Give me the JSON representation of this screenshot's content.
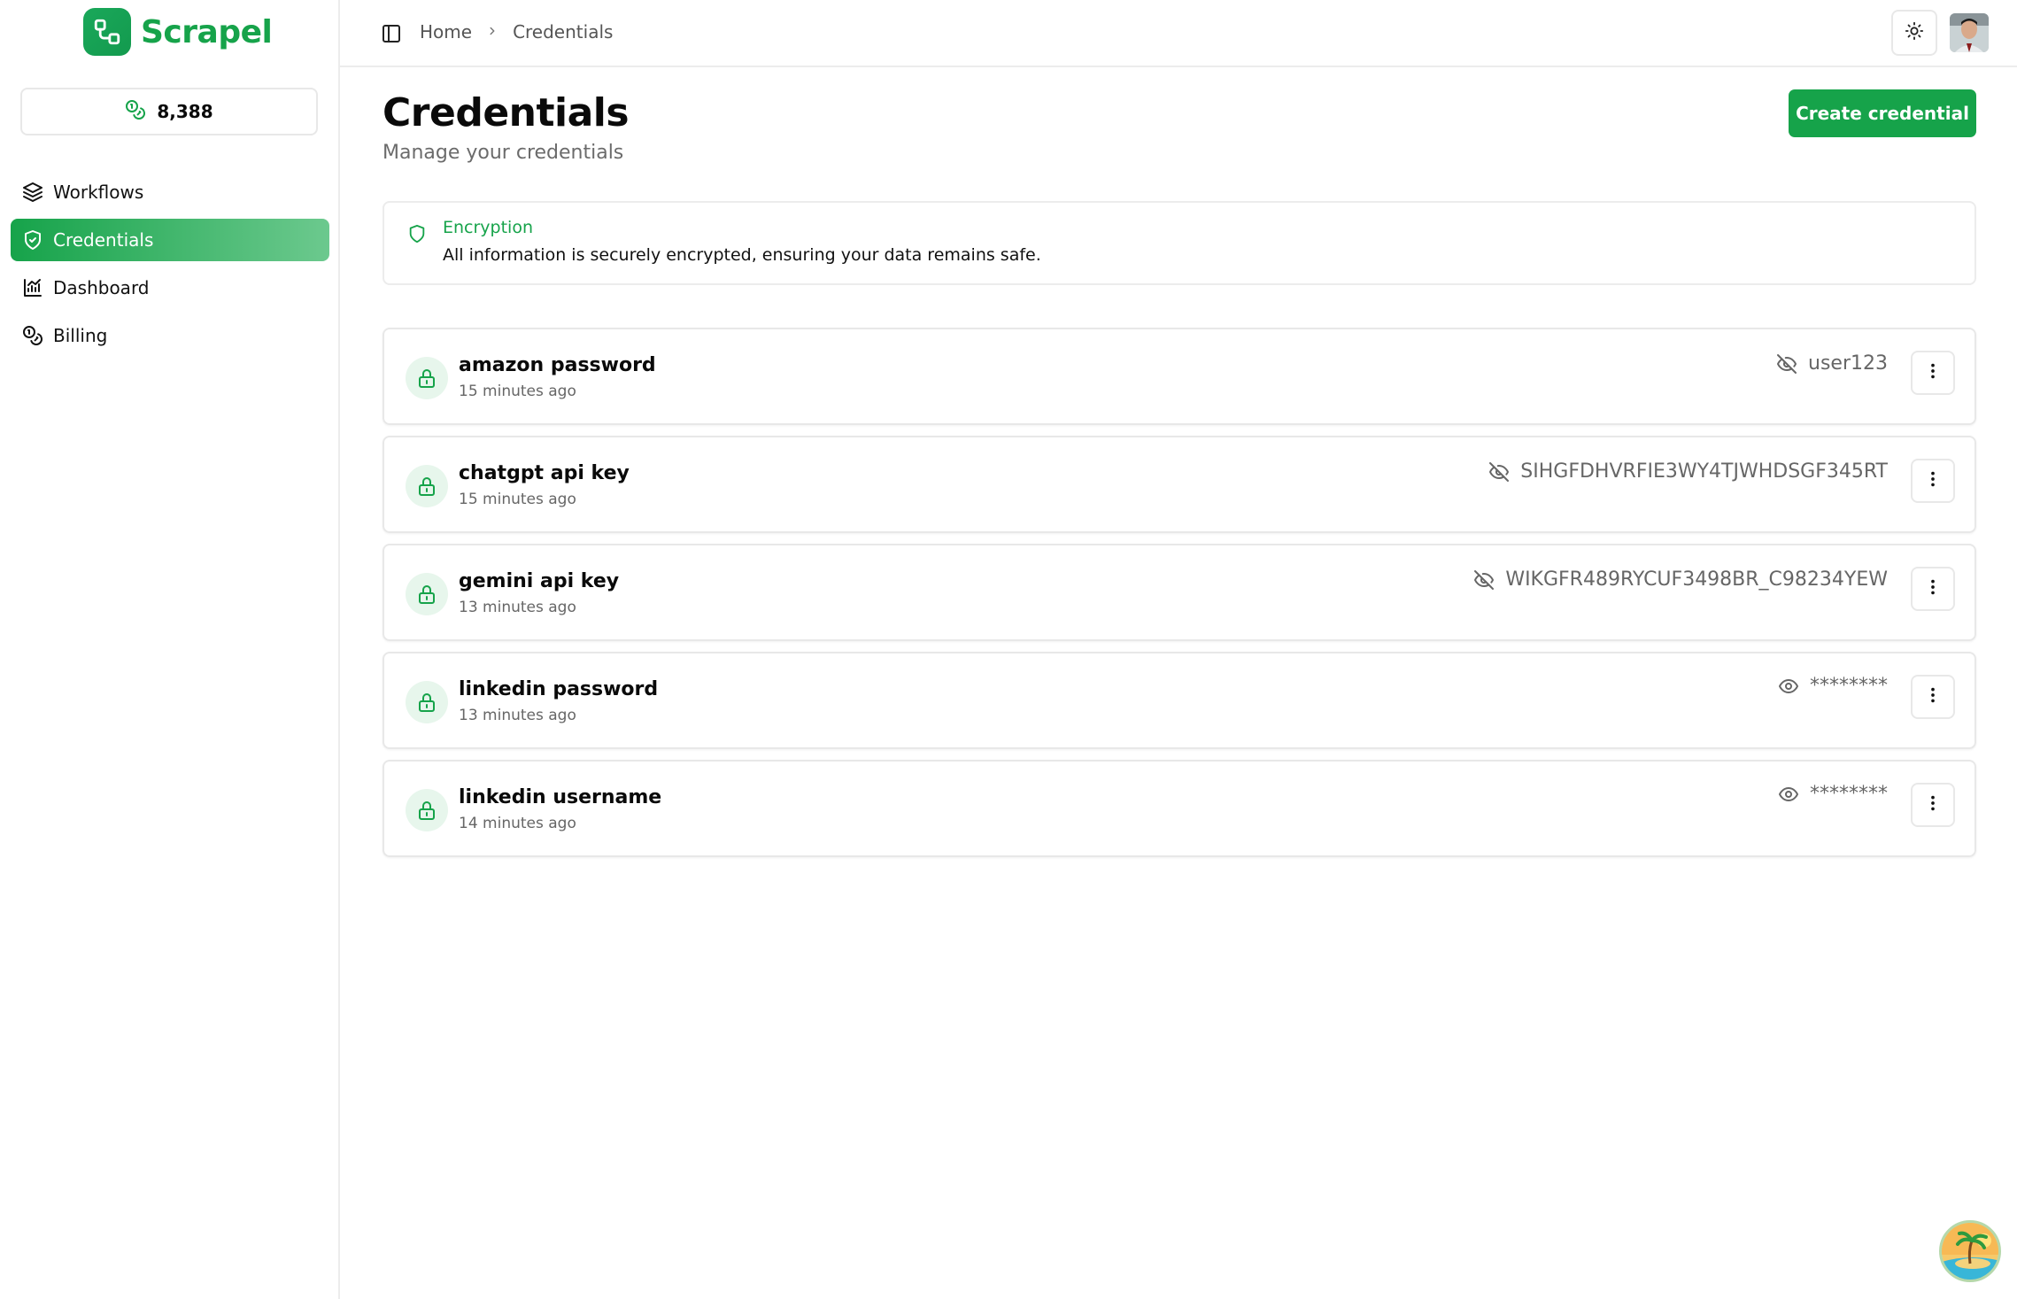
{
  "app": {
    "name": "Scrapel",
    "credits": "8,388"
  },
  "sidebar": {
    "items": [
      {
        "label": "Workflows",
        "icon": "layers-icon"
      },
      {
        "label": "Credentials",
        "icon": "shield-check-icon",
        "active": true
      },
      {
        "label": "Dashboard",
        "icon": "chart-icon"
      },
      {
        "label": "Billing",
        "icon": "coins-icon"
      }
    ]
  },
  "header": {
    "breadcrumb": [
      "Home",
      "Credentials"
    ]
  },
  "main": {
    "title": "Credentials",
    "subtitle": "Manage your credentials",
    "create_label": "Create credential",
    "alert": {
      "title": "Encryption",
      "description": "All information is securely encrypted, ensuring your data remains safe."
    },
    "credentials": [
      {
        "name": "amazon password",
        "time": "15 minutes ago",
        "value": "user123",
        "visible": true
      },
      {
        "name": "chatgpt api key",
        "time": "15 minutes ago",
        "value": "SIHGFDHVRFIE3WY4TJWHDSGF345RT",
        "visible": true
      },
      {
        "name": "gemini api key",
        "time": "13 minutes ago",
        "value": "WIKGFR489RYCUF3498BR_C98234YEW",
        "visible": true
      },
      {
        "name": "linkedin password",
        "time": "13 minutes ago",
        "value": "********",
        "visible": false
      },
      {
        "name": "linkedin username",
        "time": "14 minutes ago",
        "value": "********",
        "visible": false
      }
    ]
  },
  "colors": {
    "accent": "#16a34a",
    "accent_light": "#e7f6ec"
  }
}
